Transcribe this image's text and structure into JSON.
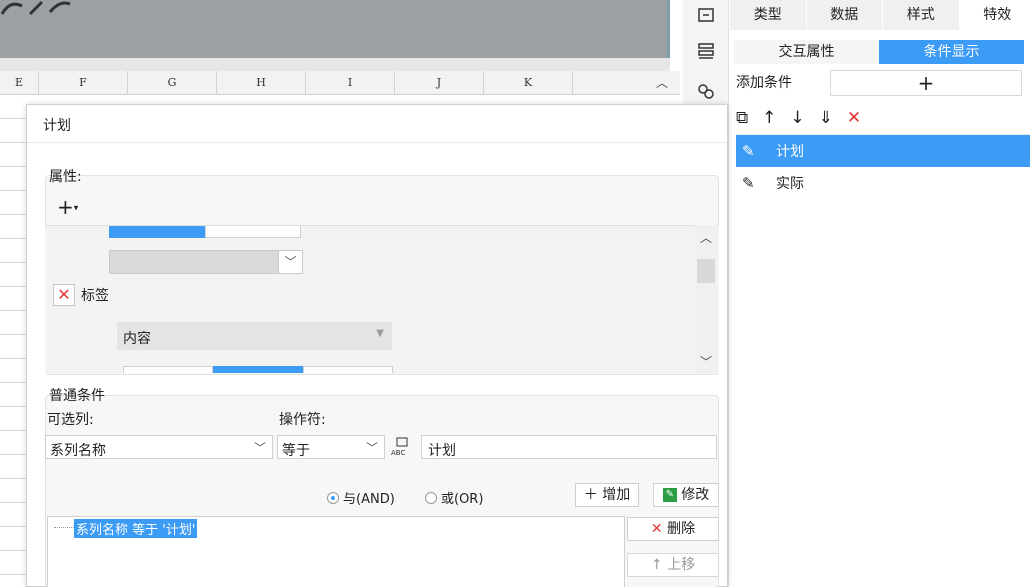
{
  "sheet": {
    "columns": [
      "E",
      "F",
      "G",
      "H",
      "I",
      "J",
      "K"
    ]
  },
  "right_panel": {
    "tabs": [
      {
        "label": "类型",
        "active": false
      },
      {
        "label": "数据",
        "active": false
      },
      {
        "label": "样式",
        "active": false
      },
      {
        "label": "特效",
        "active": true
      }
    ],
    "subtabs": [
      {
        "label": "交互属性",
        "active": false
      },
      {
        "label": "条件显示",
        "active": true
      }
    ],
    "add_condition_label": "添加条件",
    "add_condition_button": "+",
    "toolbar_icons": [
      "copy-icon",
      "arrow-up-icon",
      "arrow-down-icon",
      "move-bottom-icon",
      "delete-icon"
    ],
    "conditions": [
      {
        "label": "计划",
        "selected": true
      },
      {
        "label": "实际",
        "selected": false
      }
    ],
    "accent_color": "#3b9bf5"
  },
  "dialog": {
    "title": "计划",
    "attributes": {
      "label": "属性:",
      "add_button": "+",
      "tag_label": "标签",
      "content_label": "内容"
    },
    "normal_condition": {
      "label": "普通条件",
      "column_label": "可选列:",
      "operator_label": "操作符:",
      "column_value": "系列名称",
      "operator_value": "等于",
      "value": "计划",
      "and_label": "与(AND)",
      "or_label": "或(OR)",
      "and_selected": true,
      "add_button": "增加",
      "modify_button": "修改",
      "expression": "系列名称 等于 '计划'",
      "delete_button": "删除",
      "move_up_button": "上移"
    }
  }
}
